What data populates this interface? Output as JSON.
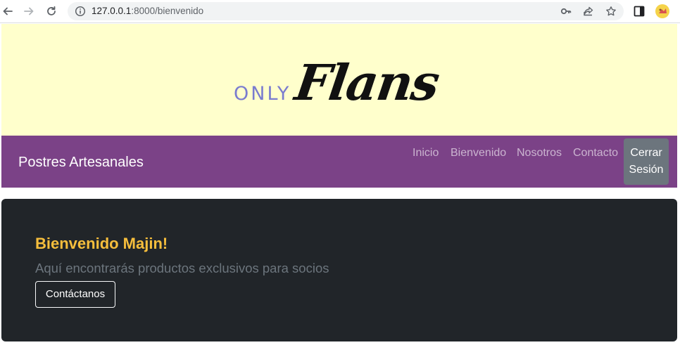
{
  "browser": {
    "url_host": "127.0.0.1",
    "url_path": ":8000/bienvenido",
    "icons": [
      "back-arrow-icon",
      "forward-arrow-icon",
      "reload-icon",
      "info-icon",
      "key-icon",
      "share-icon",
      "star-icon",
      "side-panel-icon",
      "profile-avatar-icon"
    ]
  },
  "banner": {
    "logo_only": "ONLY",
    "logo_flans": "Flans",
    "background_color": "#ffffcc"
  },
  "navbar": {
    "brand": "Postres Artesanales",
    "links": [
      "Inicio",
      "Bienvenido",
      "Nosotros",
      "Contacto"
    ],
    "logout_line1": "Cerrar",
    "logout_line2": "Sesión",
    "background_color": "#7b4287"
  },
  "hero": {
    "title": "Bienvenido Majin!",
    "subtitle": "Aquí encontrarás productos exclusivos para socios",
    "button": "Contáctanos",
    "title_color": "#f6be3c",
    "background_color": "#212529"
  }
}
